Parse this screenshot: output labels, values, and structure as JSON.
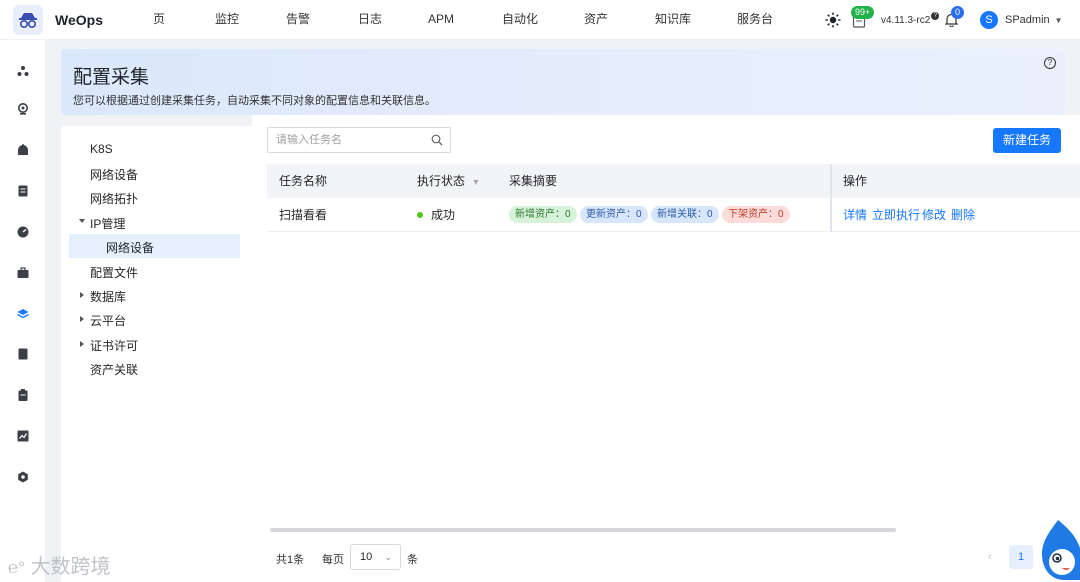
{
  "brand": {
    "name": "WeOps"
  },
  "nav": {
    "items": [
      "页",
      "监控",
      "告警",
      "日志",
      "APM",
      "自动化",
      "资产",
      "知识库",
      "服务台"
    ]
  },
  "header_tools": {
    "notification_badge": "99+",
    "version": "v4.11.3-rc2",
    "bell_badge": "0",
    "avatar_letter": "S",
    "username": "SPadmin"
  },
  "page": {
    "title": "配置采集",
    "description": "您可以根据通过创建采集任务，自动采集不同对象的配置信息和关联信息。"
  },
  "tree": {
    "items": [
      {
        "label": "K8S"
      },
      {
        "label": "网络设备"
      },
      {
        "label": "网络拓扑"
      },
      {
        "label": "IP管理",
        "expanded": true
      },
      {
        "label": "网络设备",
        "selected": true
      },
      {
        "label": "配置文件"
      },
      {
        "label": "数据库",
        "collapsed": true
      },
      {
        "label": "云平台",
        "collapsed": true
      },
      {
        "label": "证书许可",
        "collapsed": true
      },
      {
        "label": "资产关联"
      }
    ]
  },
  "toolbar": {
    "search_placeholder": "请输入任务名",
    "new_task_label": "新建任务"
  },
  "table": {
    "columns": [
      "任务名称",
      "执行状态",
      "采集摘要",
      "操作"
    ],
    "rows": [
      {
        "name": "扫描看看",
        "status": "成功",
        "tags": [
          "新增资产：0",
          "更新资产：0",
          "新增关联：0",
          "下架资产：0"
        ],
        "actions": [
          "详情",
          "立即执行",
          "修改",
          "删除"
        ]
      }
    ]
  },
  "pagination": {
    "total": "共1条",
    "per_page_label": "每页",
    "page_size": "10",
    "unit": "条",
    "prev": "‹",
    "current_page": "1"
  },
  "watermark": "大数跨境",
  "colors": {
    "primary": "#1677ff",
    "success": "#52c41a",
    "banner": "#dbe7fb"
  }
}
